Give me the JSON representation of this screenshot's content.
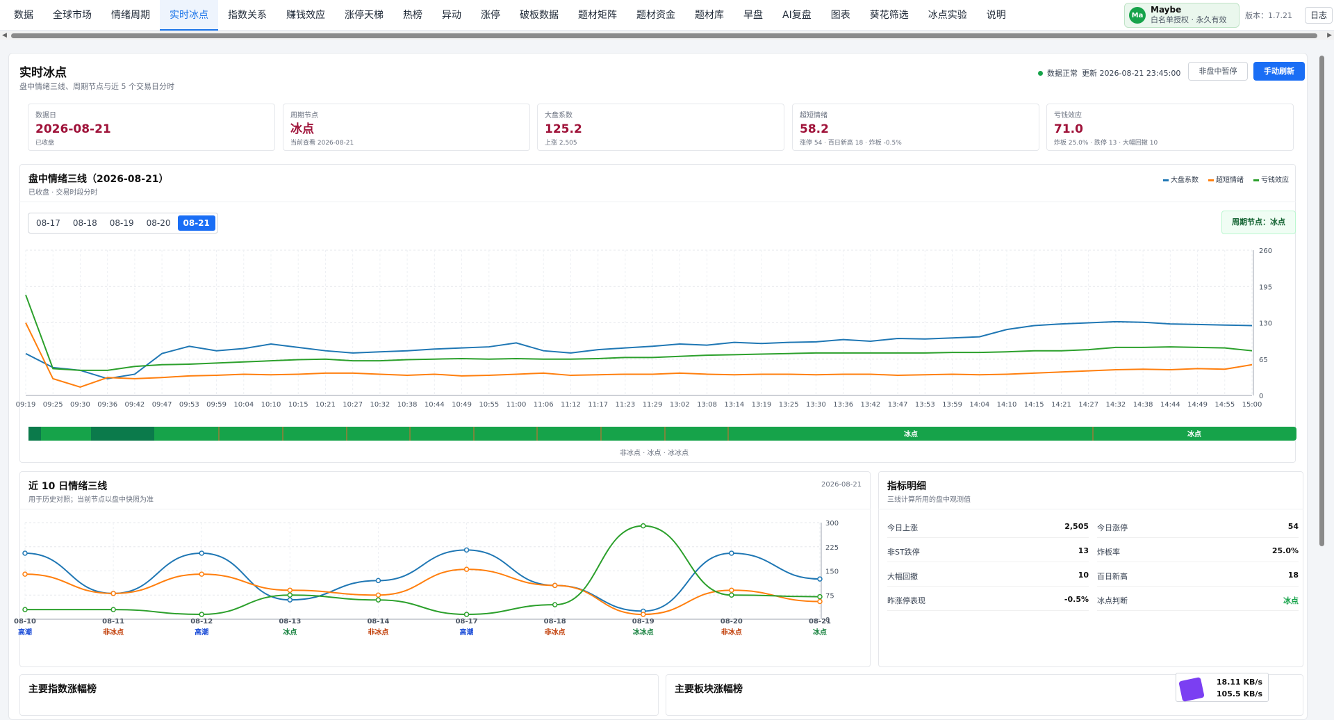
{
  "nav": {
    "tabs": [
      "数据",
      "全球市场",
      "情绪周期",
      "实时冰点",
      "指数关系",
      "赚钱效应",
      "涨停天梯",
      "热榜",
      "异动",
      "涨停",
      "破板数据",
      "题材矩阵",
      "题材资金",
      "题材库",
      "早盘",
      "AI复盘",
      "图表",
      "葵花筛选",
      "冰点实验",
      "说明"
    ],
    "active_index": 3,
    "user_avatar": "Ma",
    "user_name": "Maybe",
    "user_license": "白名单授权 · 永久有效",
    "version": "版本：1.7.21",
    "log_button": "日志"
  },
  "header": {
    "title": "实时冰点",
    "subtitle": "盘中情绪三线、周期节点与近 5 个交易日分时",
    "status": "数据正常",
    "updated": "更新 2026-08-21 23:45:00",
    "pause_button": "非盘中暂停",
    "refresh_button": "手动刷新"
  },
  "stats": [
    {
      "label": "数据日",
      "value": "2026-08-21",
      "note": "已收盘"
    },
    {
      "label": "周期节点",
      "value": "冰点",
      "note": "当前查看 2026-08-21"
    },
    {
      "label": "大盘系数",
      "value": "125.2",
      "note": "上涨 2,505"
    },
    {
      "label": "超短情绪",
      "value": "58.2",
      "note": "涨停 54 · 百日新高 18 · 炸板 -0.5%"
    },
    {
      "label": "亏钱效应",
      "value": "71.0",
      "note": "炸板 25.0% · 跌停 13 · 大幅回撤 10"
    }
  ],
  "intraday": {
    "title": "盘中情绪三线（2026-08-21）",
    "subtitle": "已收盘 · 交易时段分时",
    "legend": [
      "大盘系数",
      "超短情绪",
      "亏钱效应"
    ],
    "days": [
      "08-17",
      "08-18",
      "08-19",
      "08-20",
      "08-21"
    ],
    "active_day": 4,
    "phase_badge": "周期节点：冰点",
    "band_labels": [
      "冰点",
      "冰点"
    ],
    "band_legend": "非冰点 · 冰点 · 冰冰点"
  },
  "history": {
    "title": "近 10 日情绪三线",
    "subtitle": "用于历史对照；当前节点以盘中快照为准",
    "date": "2026-08-21"
  },
  "metrics": {
    "title": "指标明细",
    "subtitle": "三线计算所用的盘中观测值",
    "rows": [
      {
        "k": "今日上涨",
        "v": "2,505"
      },
      {
        "k": "今日涨停",
        "v": "54"
      },
      {
        "k": "非ST跌停",
        "v": "13"
      },
      {
        "k": "炸板率",
        "v": "25.0%"
      },
      {
        "k": "大幅回撤",
        "v": "10"
      },
      {
        "k": "百日新高",
        "v": "18"
      },
      {
        "k": "昨涨停表现",
        "v": "-0.5%"
      },
      {
        "k": "冰点判断",
        "v": "冰点"
      }
    ]
  },
  "bottom": {
    "left_title": "主要指数涨幅榜",
    "right_title": "主要板块涨幅榜"
  },
  "speed": {
    "up": "18.11 KB/s",
    "down": "105.5 KB/s"
  },
  "colors": {
    "blue": "#1f77b4",
    "orange": "#ff7f0e",
    "green": "#2ca02c",
    "accent": "#1a6ef5"
  },
  "chart_data": [
    {
      "type": "line",
      "title": "盘中情绪三线（2026-08-21）",
      "x": [
        "09:19",
        "09:25",
        "09:30",
        "09:36",
        "09:42",
        "09:47",
        "09:53",
        "09:59",
        "10:04",
        "10:10",
        "10:15",
        "10:21",
        "10:27",
        "10:32",
        "10:38",
        "10:44",
        "10:49",
        "10:55",
        "11:00",
        "11:06",
        "11:12",
        "11:17",
        "11:23",
        "11:29",
        "13:02",
        "13:08",
        "13:14",
        "13:19",
        "13:25",
        "13:30",
        "13:36",
        "13:42",
        "13:47",
        "13:53",
        "13:59",
        "14:04",
        "14:10",
        "14:15",
        "14:21",
        "14:27",
        "14:32",
        "14:38",
        "14:44",
        "14:49",
        "14:55",
        "15:00"
      ],
      "ylim": [
        0,
        260
      ],
      "yticks": [
        0,
        65,
        130,
        195,
        260
      ],
      "series": [
        {
          "name": "大盘系数",
          "values": [
            75,
            50,
            45,
            30,
            38,
            75,
            88,
            80,
            84,
            92,
            86,
            80,
            76,
            78,
            80,
            83,
            85,
            87,
            94,
            80,
            76,
            82,
            85,
            88,
            92,
            90,
            95,
            93,
            95,
            96,
            100,
            97,
            102,
            101,
            103,
            105,
            118,
            125,
            128,
            130,
            132,
            131,
            128,
            127,
            126,
            125
          ]
        },
        {
          "name": "超短情绪",
          "values": [
            130,
            30,
            15,
            32,
            30,
            32,
            35,
            36,
            38,
            37,
            38,
            40,
            40,
            38,
            36,
            38,
            35,
            36,
            38,
            40,
            36,
            37,
            38,
            38,
            40,
            38,
            37,
            38,
            38,
            37,
            38,
            38,
            36,
            37,
            38,
            37,
            38,
            40,
            42,
            44,
            46,
            47,
            46,
            48,
            47,
            55
          ]
        },
        {
          "name": "亏钱效应",
          "values": [
            180,
            48,
            45,
            45,
            52,
            55,
            56,
            58,
            60,
            62,
            64,
            65,
            62,
            62,
            64,
            65,
            66,
            65,
            66,
            65,
            65,
            66,
            68,
            68,
            70,
            72,
            73,
            74,
            75,
            76,
            76,
            76,
            76,
            76,
            77,
            77,
            78,
            80,
            80,
            82,
            86,
            86,
            87,
            86,
            85,
            80
          ]
        }
      ]
    },
    {
      "type": "line",
      "title": "近 10 日情绪三线",
      "x": [
        "08-10",
        "08-11",
        "08-12",
        "08-13",
        "08-14",
        "08-17",
        "08-18",
        "08-19",
        "08-20",
        "08-21"
      ],
      "phases": [
        "高潮",
        "非冰点",
        "高潮",
        "冰点",
        "非冰点",
        "高潮",
        "非冰点",
        "冰冰点",
        "非冰点",
        "冰点"
      ],
      "ylim": [
        0,
        300
      ],
      "yticks": [
        0,
        75,
        150,
        225,
        300
      ],
      "series": [
        {
          "name": "大盘系数",
          "values": [
            205,
            80,
            205,
            60,
            120,
            215,
            105,
            25,
            205,
            125
          ]
        },
        {
          "name": "超短情绪",
          "values": [
            140,
            80,
            140,
            90,
            75,
            155,
            105,
            15,
            90,
            55
          ]
        },
        {
          "name": "亏钱效应",
          "values": [
            30,
            30,
            15,
            75,
            60,
            15,
            45,
            290,
            75,
            70
          ]
        }
      ]
    }
  ]
}
